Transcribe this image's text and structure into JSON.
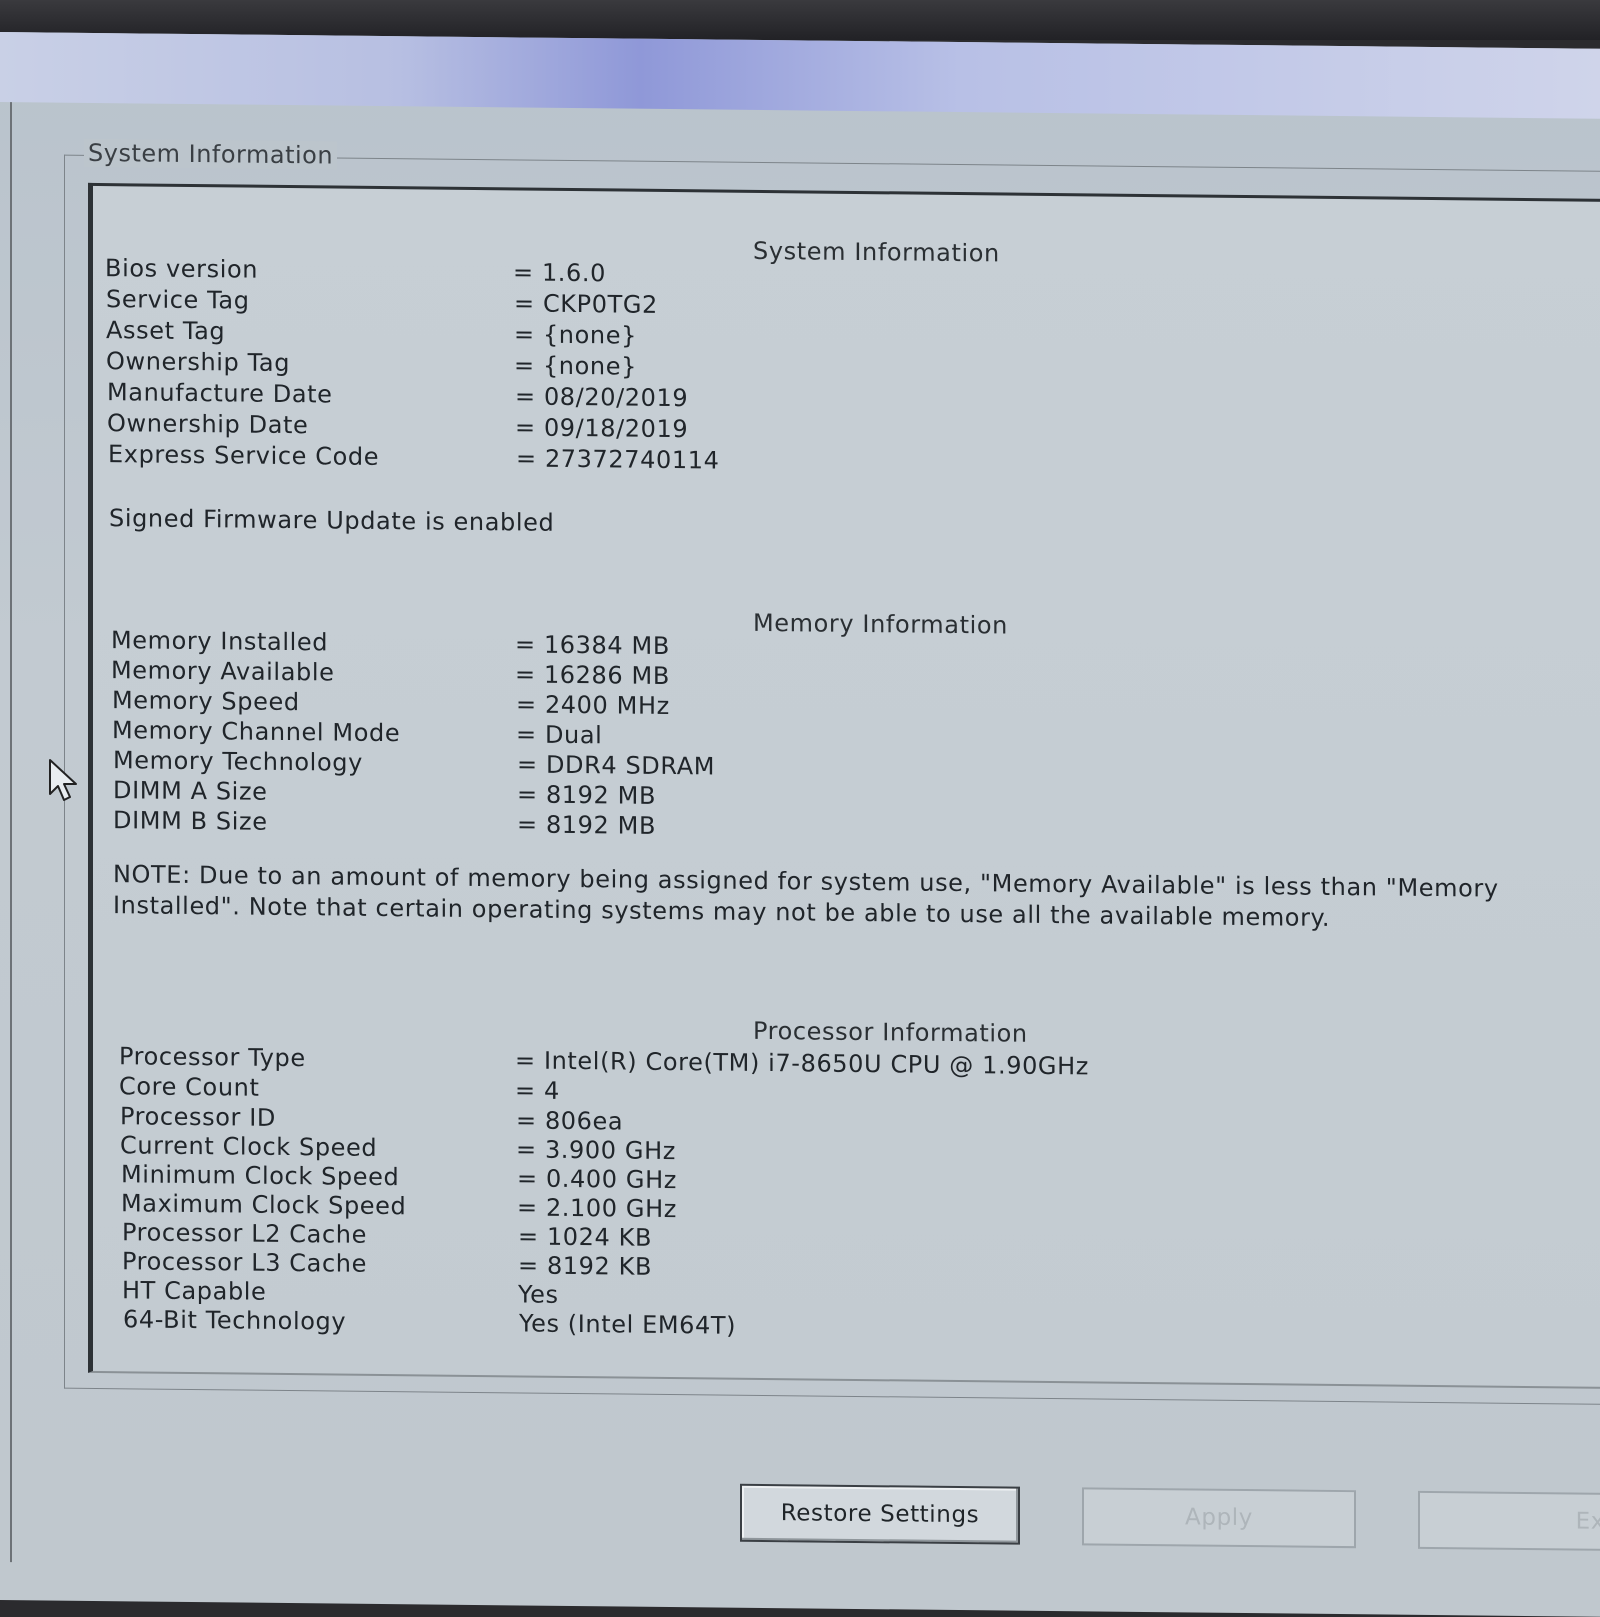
{
  "groupbox_title": "System Information",
  "system": {
    "title": "System Information",
    "rows": [
      {
        "label": "Bios version",
        "value": "= 1.6.0"
      },
      {
        "label": "Service Tag",
        "value": "= CKP0TG2"
      },
      {
        "label": "Asset Tag",
        "value": "= {none}"
      },
      {
        "label": "Ownership Tag",
        "value": "= {none}"
      },
      {
        "label": "Manufacture Date",
        "value": "= 08/20/2019"
      },
      {
        "label": "Ownership Date",
        "value": "= 09/18/2019"
      },
      {
        "label": "Express Service Code",
        "value": "= 27372740114"
      }
    ],
    "signed_firmware": "Signed Firmware Update is enabled"
  },
  "memory": {
    "title": "Memory Information",
    "rows": [
      {
        "label": "Memory Installed",
        "value": "= 16384 MB"
      },
      {
        "label": "Memory Available",
        "value": "= 16286 MB"
      },
      {
        "label": "Memory Speed",
        "value": "= 2400 MHz"
      },
      {
        "label": "Memory Channel Mode",
        "value": "= Dual"
      },
      {
        "label": "Memory Technology",
        "value": "= DDR4 SDRAM"
      },
      {
        "label": "DIMM A Size",
        "value": "= 8192 MB"
      },
      {
        "label": "DIMM B Size",
        "value": "= 8192 MB"
      }
    ],
    "note": "NOTE: Due to an amount of memory being assigned for system use, \"Memory Available\" is less than \"Memory Installed\". Note that certain operating systems may not be able to use all the available memory."
  },
  "processor": {
    "title": "Processor Information",
    "rows": [
      {
        "label": "Processor Type",
        "value": "= Intel(R) Core(TM) i7-8650U CPU @ 1.90GHz"
      },
      {
        "label": "Core Count",
        "value": "= 4"
      },
      {
        "label": "Processor ID",
        "value": "= 806ea"
      },
      {
        "label": "Current Clock Speed",
        "value": "= 3.900 GHz"
      },
      {
        "label": "Minimum Clock Speed",
        "value": "= 0.400 GHz"
      },
      {
        "label": "Maximum Clock Speed",
        "value": "= 2.100 GHz"
      },
      {
        "label": "Processor L2 Cache",
        "value": "= 1024 KB"
      },
      {
        "label": "Processor L3 Cache",
        "value": "= 8192 KB"
      },
      {
        "label": "HT Capable",
        "value": "Yes"
      },
      {
        "label": "64-Bit Technology",
        "value": "Yes (Intel EM64T)"
      }
    ]
  },
  "buttons": {
    "restore": "Restore Settings",
    "apply": "Apply",
    "exit": "Exi"
  },
  "icons": {
    "cursor": "mouse-pointer-icon"
  }
}
